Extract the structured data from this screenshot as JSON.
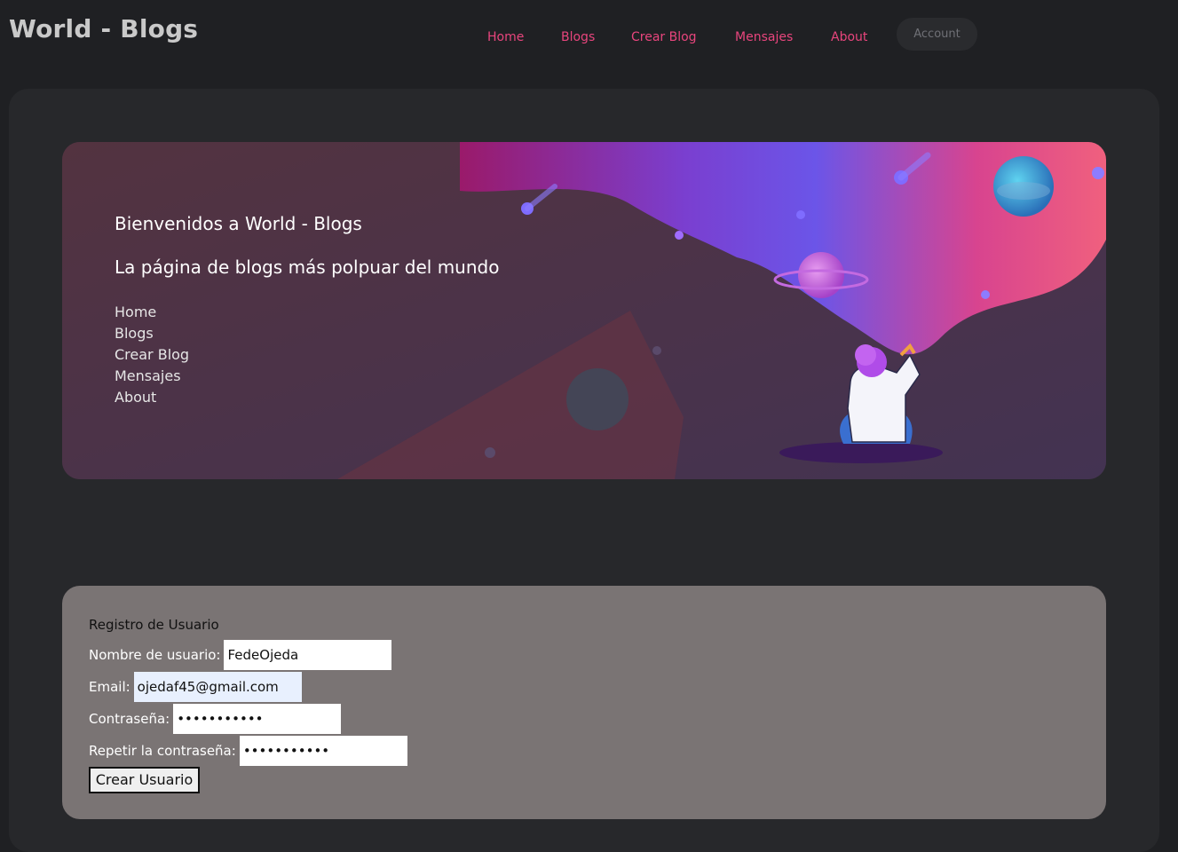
{
  "brand": "World - Blogs",
  "nav": {
    "items": [
      "Home",
      "Blogs",
      "Crear Blog",
      "Mensajes",
      "About"
    ],
    "account_label": "Account"
  },
  "hero": {
    "title": "Bienvenidos a World - Blogs",
    "subtitle": "La página de blogs más polpuar del mundo",
    "links": [
      "Home",
      "Blogs",
      "Crear Blog",
      "Mensajes",
      "About"
    ]
  },
  "form": {
    "title": "Registro de Usuario",
    "username_label": "Nombre de usuario:",
    "username_value": "FedeOjeda",
    "email_label": "Email:",
    "email_value": "ojedaf45@gmail.com",
    "password_label": "Contraseña:",
    "password_value": "•••••••••••",
    "password_repeat_label": "Repetir la contraseña:",
    "password_repeat_value": "•••••••••••",
    "submit_label": "Crear Usuario"
  },
  "colors": {
    "accent": "#e8457d",
    "background": "#1f2023",
    "panel": "#27282b",
    "form_panel": "#7a7474"
  }
}
